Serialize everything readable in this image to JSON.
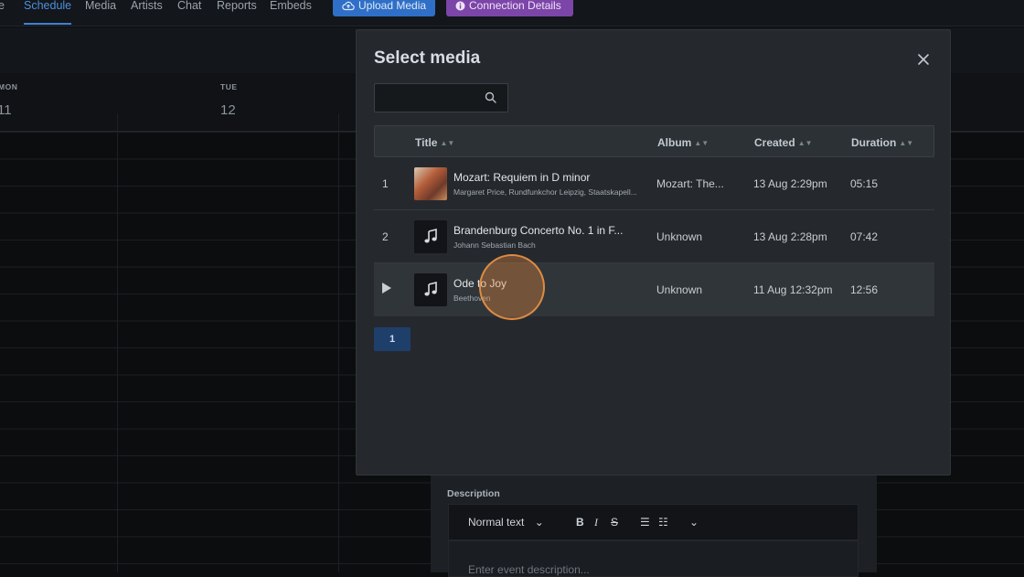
{
  "nav": {
    "items": [
      {
        "label": "e"
      },
      {
        "label": "Schedule"
      },
      {
        "label": "Media"
      },
      {
        "label": "Artists"
      },
      {
        "label": "Chat"
      },
      {
        "label": "Reports"
      },
      {
        "label": "Embeds"
      }
    ],
    "upload_label": "Upload Media",
    "connection_label": "Connection Details"
  },
  "calendar": {
    "days": [
      {
        "name": "MON",
        "num": "11"
      },
      {
        "name": "TUE",
        "num": "12"
      }
    ]
  },
  "event_form": {
    "description_label": "Description",
    "format_select": "Normal text",
    "placeholder": "Enter event description..."
  },
  "modal": {
    "title": "Select media",
    "search": {
      "placeholder": ""
    },
    "columns": {
      "title": "Title",
      "album": "Album",
      "created": "Created",
      "duration": "Duration"
    },
    "rows": [
      {
        "index": "1",
        "title": "Mozart: Requiem in D minor",
        "artist": "Margaret Price, Rundfunkchor Leipzig, Staatskapell...",
        "album": "Mozart: The...",
        "created": "13 Aug 2:29pm",
        "duration": "05:15",
        "thumb": "album-art"
      },
      {
        "index": "2",
        "title": "Brandenburg Concerto No. 1 in F...",
        "artist": "Johann Sebastian Bach",
        "album": "Unknown",
        "created": "13 Aug 2:28pm",
        "duration": "07:42",
        "thumb": "music-note-icon"
      },
      {
        "index": "",
        "title": "Ode to Joy",
        "artist": "Beethoven",
        "album": "Unknown",
        "created": "11 Aug 12:32pm",
        "duration": "12:56",
        "thumb": "music-note-icon"
      }
    ],
    "pagination": {
      "current": "1"
    }
  }
}
